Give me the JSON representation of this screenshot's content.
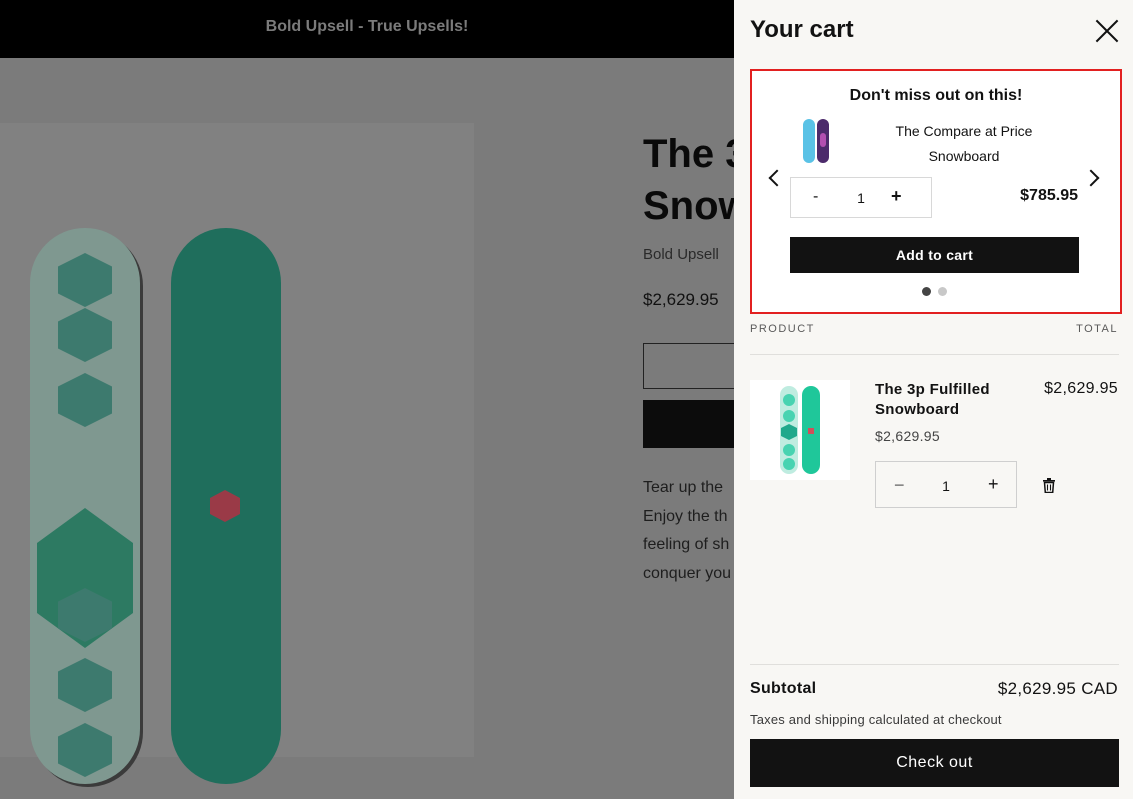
{
  "announcement": {
    "text": "Bold Upsell - True Upsells!"
  },
  "product": {
    "title": "The 3\nSnow",
    "vendor": "Bold Upsell",
    "price": "$2,629.95",
    "description": "Tear up the\nEnjoy the th\nfeeling of sh\nconquer you"
  },
  "cart": {
    "title": "Your cart",
    "upsell": {
      "heading": "Don't miss out on this!",
      "product_name": "The Compare at Price Snowboard",
      "quantity": "1",
      "minus_label": "-",
      "plus_label": "+",
      "price": "$785.95",
      "add_label": "Add to cart",
      "slides_total": 2,
      "active_slide": 1
    },
    "columns": {
      "product": "PRODUCT",
      "total": "TOTAL"
    },
    "items": [
      {
        "title": "The 3p Fulfilled Snowboard",
        "unit_price": "$2,629.95",
        "line_total": "$2,629.95",
        "quantity": "1"
      }
    ],
    "qty_minus": "−",
    "qty_plus": "+",
    "subtotal_label": "Subtotal",
    "subtotal_value": "$2,629.95 CAD",
    "tax_note": "Taxes and shipping calculated at checkout",
    "checkout_label": "Check out"
  },
  "colors": {
    "overlay": "#7a7a7a",
    "drawer_bg": "#f8f7f4",
    "upsell_border": "#e22020",
    "button": "#121212"
  },
  "icons": [
    "close-icon",
    "chevron-left-icon",
    "chevron-right-icon",
    "trash-icon"
  ]
}
